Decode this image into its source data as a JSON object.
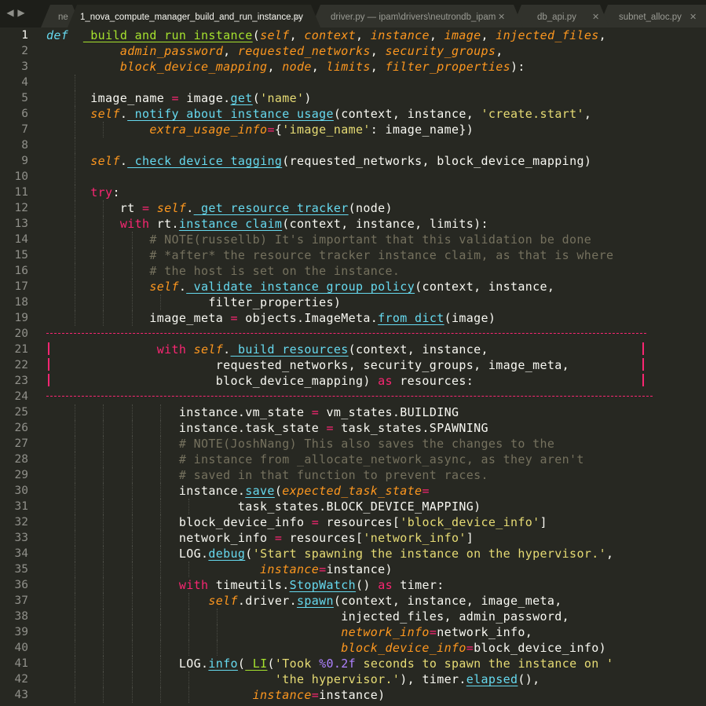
{
  "nav": {
    "back_icon": "◀",
    "forward_icon": "▶"
  },
  "tabs": [
    {
      "label": "ne",
      "close": ""
    },
    {
      "label": "1_nova_compute_manager_build_and_run_instance.py",
      "close": "✕",
      "active": true
    },
    {
      "label": "driver.py — ipam\\drivers\\neutrondb_ipam",
      "close": "✕"
    },
    {
      "label": "db_api.py",
      "close": "✕"
    },
    {
      "label": "subnet_alloc.py",
      "close": "✕"
    }
  ],
  "colors": {
    "background": "#272822",
    "keyword": "#f92672",
    "string": "#e6db74",
    "function": "#a6e22e",
    "builtin": "#66d9ef",
    "parameter": "#fd971f",
    "comment": "#75715e",
    "number": "#ae81ff",
    "diff_marker": "#f92672"
  },
  "editor": {
    "current_line": 1,
    "lines": [
      {
        "n": "1",
        "guides": 0,
        "t": [
          [
            "d",
            "def"
          ],
          [
            "",
            "  "
          ],
          [
            "f u",
            "_build_and_run_instance"
          ],
          [
            "",
            "("
          ],
          [
            "p",
            "self"
          ],
          [
            "",
            ", "
          ],
          [
            "p",
            "context"
          ],
          [
            "",
            ", "
          ],
          [
            "p",
            "instance"
          ],
          [
            "",
            ", "
          ],
          [
            "p",
            "image"
          ],
          [
            "",
            ", "
          ],
          [
            "p",
            "injected_files"
          ],
          [
            "",
            ","
          ]
        ]
      },
      {
        "n": "2",
        "guides": 0,
        "t": [
          [
            "",
            "          "
          ],
          [
            "p",
            "admin_password"
          ],
          [
            "",
            ", "
          ],
          [
            "p",
            "requested_networks"
          ],
          [
            "",
            ", "
          ],
          [
            "p",
            "security_groups"
          ],
          [
            "",
            ","
          ]
        ]
      },
      {
        "n": "3",
        "guides": 0,
        "t": [
          [
            "",
            "          "
          ],
          [
            "p",
            "block_device_mapping"
          ],
          [
            "",
            ", "
          ],
          [
            "p",
            "node"
          ],
          [
            "",
            ", "
          ],
          [
            "p",
            "limits"
          ],
          [
            "",
            ", "
          ],
          [
            "p",
            "filter_properties"
          ],
          [
            "",
            "):"
          ]
        ]
      },
      {
        "n": "4",
        "guides": 1,
        "t": []
      },
      {
        "n": "5",
        "guides": 1,
        "t": [
          [
            "",
            "      image_name "
          ],
          [
            "k",
            "="
          ],
          [
            "",
            " image."
          ],
          [
            "b u",
            "get"
          ],
          [
            "",
            "("
          ],
          [
            "s",
            "'name'"
          ],
          [
            "",
            ")"
          ]
        ]
      },
      {
        "n": "6",
        "guides": 1,
        "t": [
          [
            "",
            "      "
          ],
          [
            "p",
            "self"
          ],
          [
            "",
            "."
          ],
          [
            "b u",
            "_notify_about_instance_usage"
          ],
          [
            "",
            "(context, instance, "
          ],
          [
            "s",
            "'create.start'"
          ],
          [
            "",
            ","
          ]
        ]
      },
      {
        "n": "7",
        "guides": 2,
        "t": [
          [
            "",
            "              "
          ],
          [
            "p",
            "extra_usage_info"
          ],
          [
            "k",
            "="
          ],
          [
            "",
            "{"
          ],
          [
            "s",
            "'image_name'"
          ],
          [
            "",
            ": image_name})"
          ]
        ]
      },
      {
        "n": "8",
        "guides": 1,
        "t": []
      },
      {
        "n": "9",
        "guides": 1,
        "t": [
          [
            "",
            "      "
          ],
          [
            "p",
            "self"
          ],
          [
            "",
            "."
          ],
          [
            "b u",
            "_check_device_tagging"
          ],
          [
            "",
            "(requested_networks, block_device_mapping)"
          ]
        ]
      },
      {
        "n": "10",
        "guides": 1,
        "t": []
      },
      {
        "n": "11",
        "guides": 1,
        "t": [
          [
            "",
            "      "
          ],
          [
            "k",
            "try"
          ],
          [
            "",
            ":"
          ]
        ]
      },
      {
        "n": "12",
        "guides": 2,
        "t": [
          [
            "",
            "          rt "
          ],
          [
            "k",
            "="
          ],
          [
            "",
            " "
          ],
          [
            "p",
            "self"
          ],
          [
            "",
            "."
          ],
          [
            "b u",
            "_get_resource_tracker"
          ],
          [
            "",
            "(node)"
          ]
        ]
      },
      {
        "n": "13",
        "guides": 2,
        "t": [
          [
            "",
            "          "
          ],
          [
            "k",
            "with"
          ],
          [
            "",
            " rt."
          ],
          [
            "b u",
            "instance_claim"
          ],
          [
            "",
            "(context, instance, limits):"
          ]
        ]
      },
      {
        "n": "14",
        "guides": 3,
        "t": [
          [
            "",
            "              "
          ],
          [
            "c",
            "# NOTE(russellb) It's important that this validation be done"
          ]
        ]
      },
      {
        "n": "15",
        "guides": 3,
        "t": [
          [
            "",
            "              "
          ],
          [
            "c",
            "# *after* the resource tracker instance claim, as that is where"
          ]
        ]
      },
      {
        "n": "16",
        "guides": 3,
        "t": [
          [
            "",
            "              "
          ],
          [
            "c",
            "# the host is set on the instance."
          ]
        ]
      },
      {
        "n": "17",
        "guides": 3,
        "t": [
          [
            "",
            "              "
          ],
          [
            "p",
            "self"
          ],
          [
            "",
            "."
          ],
          [
            "b u",
            "_validate_instance_group_policy"
          ],
          [
            "",
            "(context, instance,"
          ]
        ]
      },
      {
        "n": "18",
        "guides": 4,
        "t": [
          [
            "",
            "                      filter_properties)"
          ]
        ]
      },
      {
        "n": "19",
        "guides": 3,
        "t": [
          [
            "",
            "              image_meta "
          ],
          [
            "k",
            "="
          ],
          [
            "",
            " objects.ImageMeta."
          ],
          [
            "b u",
            "from_dict"
          ],
          [
            "",
            "(image)"
          ]
        ]
      },
      {
        "n": "20",
        "guides": 0,
        "t": []
      },
      {
        "n": "21",
        "guides": 0,
        "t": [
          [
            "",
            "               "
          ],
          [
            "k",
            "with"
          ],
          [
            "",
            " "
          ],
          [
            "p",
            "self"
          ],
          [
            "",
            "."
          ],
          [
            "b u",
            "_build_resources"
          ],
          [
            "",
            "(context, instance,"
          ]
        ]
      },
      {
        "n": "22",
        "guides": 0,
        "t": [
          [
            "",
            "                       requested_networks, security_groups, image_meta,"
          ]
        ]
      },
      {
        "n": "23",
        "guides": 0,
        "t": [
          [
            "",
            "                       block_device_mapping) "
          ],
          [
            "k",
            "as"
          ],
          [
            "",
            " resources:"
          ]
        ]
      },
      {
        "n": "24",
        "guides": 0,
        "t": []
      },
      {
        "n": "25",
        "guides": 4,
        "t": [
          [
            "",
            "                  instance.vm_state "
          ],
          [
            "k",
            "="
          ],
          [
            "",
            " vm_states.BUILDING"
          ]
        ]
      },
      {
        "n": "26",
        "guides": 4,
        "t": [
          [
            "",
            "                  instance.task_state "
          ],
          [
            "k",
            "="
          ],
          [
            "",
            " task_states.SPAWNING"
          ]
        ]
      },
      {
        "n": "27",
        "guides": 4,
        "t": [
          [
            "",
            "                  "
          ],
          [
            "c",
            "# NOTE(JoshNang) This also saves the changes to the"
          ]
        ]
      },
      {
        "n": "28",
        "guides": 4,
        "t": [
          [
            "",
            "                  "
          ],
          [
            "c",
            "# instance from _allocate_network_async, as they aren't"
          ]
        ]
      },
      {
        "n": "29",
        "guides": 4,
        "t": [
          [
            "",
            "                  "
          ],
          [
            "c",
            "# saved in that function to prevent races."
          ]
        ]
      },
      {
        "n": "30",
        "guides": 4,
        "t": [
          [
            "",
            "                  instance."
          ],
          [
            "b u",
            "save"
          ],
          [
            "",
            "("
          ],
          [
            "p",
            "expected_task_state"
          ],
          [
            "k",
            "="
          ]
        ]
      },
      {
        "n": "31",
        "guides": 5,
        "t": [
          [
            "",
            "                          task_states.BLOCK_DEVICE_MAPPING)"
          ]
        ]
      },
      {
        "n": "32",
        "guides": 4,
        "t": [
          [
            "",
            "                  block_device_info "
          ],
          [
            "k",
            "="
          ],
          [
            "",
            " resources["
          ],
          [
            "s",
            "'block_device_info'"
          ],
          [
            "",
            "]"
          ]
        ]
      },
      {
        "n": "33",
        "guides": 4,
        "t": [
          [
            "",
            "                  network_info "
          ],
          [
            "k",
            "="
          ],
          [
            "",
            " resources["
          ],
          [
            "s",
            "'network_info'"
          ],
          [
            "",
            "]"
          ]
        ]
      },
      {
        "n": "34",
        "guides": 4,
        "t": [
          [
            "",
            "                  LOG."
          ],
          [
            "b u",
            "debug"
          ],
          [
            "",
            "("
          ],
          [
            "s",
            "'Start spawning the instance on the hypervisor.'"
          ],
          [
            "",
            ","
          ]
        ]
      },
      {
        "n": "35",
        "guides": 5,
        "t": [
          [
            "",
            "                             "
          ],
          [
            "p",
            "instance"
          ],
          [
            "k",
            "="
          ],
          [
            "",
            "instance)"
          ]
        ]
      },
      {
        "n": "36",
        "guides": 4,
        "t": [
          [
            "",
            "                  "
          ],
          [
            "k",
            "with"
          ],
          [
            "",
            " timeutils."
          ],
          [
            "b u",
            "StopWatch"
          ],
          [
            "",
            "() "
          ],
          [
            "k",
            "as"
          ],
          [
            "",
            " timer:"
          ]
        ]
      },
      {
        "n": "37",
        "guides": 5,
        "t": [
          [
            "",
            "                      "
          ],
          [
            "p",
            "self"
          ],
          [
            "",
            ".driver."
          ],
          [
            "b u",
            "spawn"
          ],
          [
            "",
            "(context, instance, image_meta,"
          ]
        ]
      },
      {
        "n": "38",
        "guides": 6,
        "t": [
          [
            "",
            "                                        injected_files, admin_password,"
          ]
        ]
      },
      {
        "n": "39",
        "guides": 6,
        "t": [
          [
            "",
            "                                        "
          ],
          [
            "p",
            "network_info"
          ],
          [
            "k",
            "="
          ],
          [
            "",
            "network_info,"
          ]
        ]
      },
      {
        "n": "40",
        "guides": 6,
        "t": [
          [
            "",
            "                                        "
          ],
          [
            "p",
            "block_device_info"
          ],
          [
            "k",
            "="
          ],
          [
            "",
            "block_device_info)"
          ]
        ]
      },
      {
        "n": "41",
        "guides": 4,
        "t": [
          [
            "",
            "                  LOG."
          ],
          [
            "b u",
            "info"
          ],
          [
            "",
            "("
          ],
          [
            "f u",
            "_LI"
          ],
          [
            "",
            "("
          ],
          [
            "s",
            "'Took "
          ],
          [
            "n",
            "%0.2f"
          ],
          [
            "s",
            " seconds to spawn the instance on '"
          ]
        ]
      },
      {
        "n": "42",
        "guides": 5,
        "t": [
          [
            "",
            "                               "
          ],
          [
            "s",
            "'the hypervisor.'"
          ],
          [
            "",
            "), timer."
          ],
          [
            "b u",
            "elapsed"
          ],
          [
            "",
            "(),"
          ]
        ]
      },
      {
        "n": "43",
        "guides": 5,
        "t": [
          [
            "",
            "                            "
          ],
          [
            "p",
            "instance"
          ],
          [
            "k",
            "="
          ],
          [
            "",
            "instance)"
          ]
        ]
      }
    ]
  }
}
